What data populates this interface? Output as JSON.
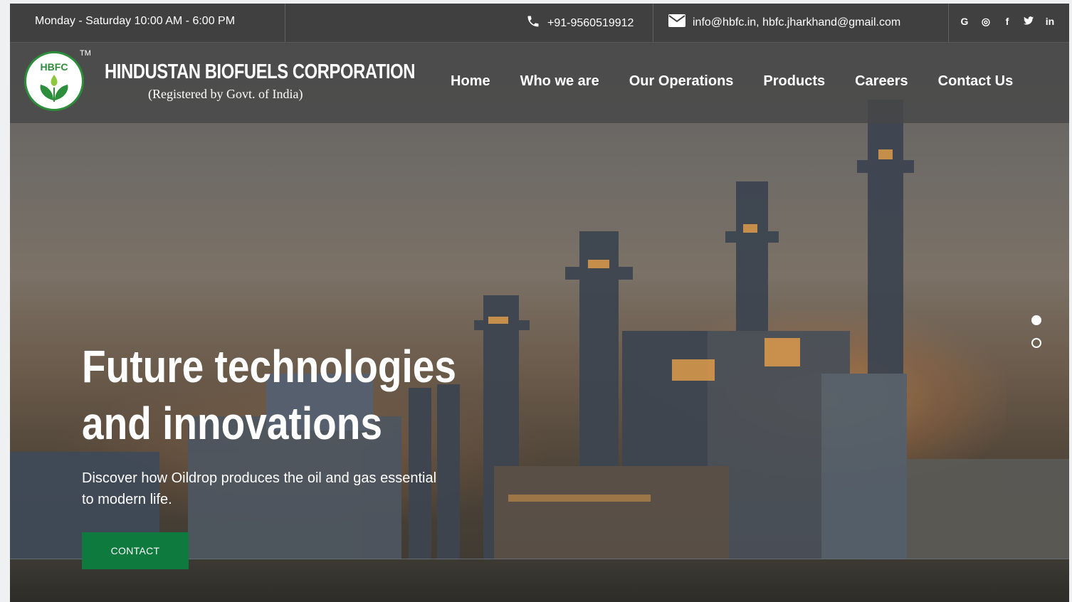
{
  "topbar": {
    "hours": "Monday - Saturday  10:00 AM - 6:00 PM",
    "phone": "+91-9560519912",
    "email": "info@hbfc.in, hbfc.jharkhand@gmail.com",
    "social": [
      {
        "icon": "google-icon",
        "glyph": "G"
      },
      {
        "icon": "whatsapp-icon",
        "glyph": "◎"
      },
      {
        "icon": "facebook-icon",
        "glyph": "f"
      },
      {
        "icon": "twitter-icon",
        "glyph": "🐦"
      },
      {
        "icon": "linkedin-icon",
        "glyph": "in"
      }
    ]
  },
  "brand": {
    "logo_text": "HBFC",
    "tm": "TM",
    "name": "HINDUSTAN BIOFUELS CORPORATION",
    "subtitle": "(Registered by Govt. of India)"
  },
  "nav": {
    "items": [
      "Home",
      "Who we are",
      "Our Operations",
      "Products",
      "Careers",
      "Contact Us"
    ]
  },
  "hero": {
    "title_line1": "Future technologies",
    "title_line2": "and innovations",
    "subtitle": "Discover how Oildrop produces the oil and gas essential to modern life.",
    "cta": "CONTACT",
    "slides": 2,
    "active_slide": 1
  },
  "colors": {
    "accent_green": "#0e7a3e",
    "logo_green": "#2c8d3a"
  }
}
